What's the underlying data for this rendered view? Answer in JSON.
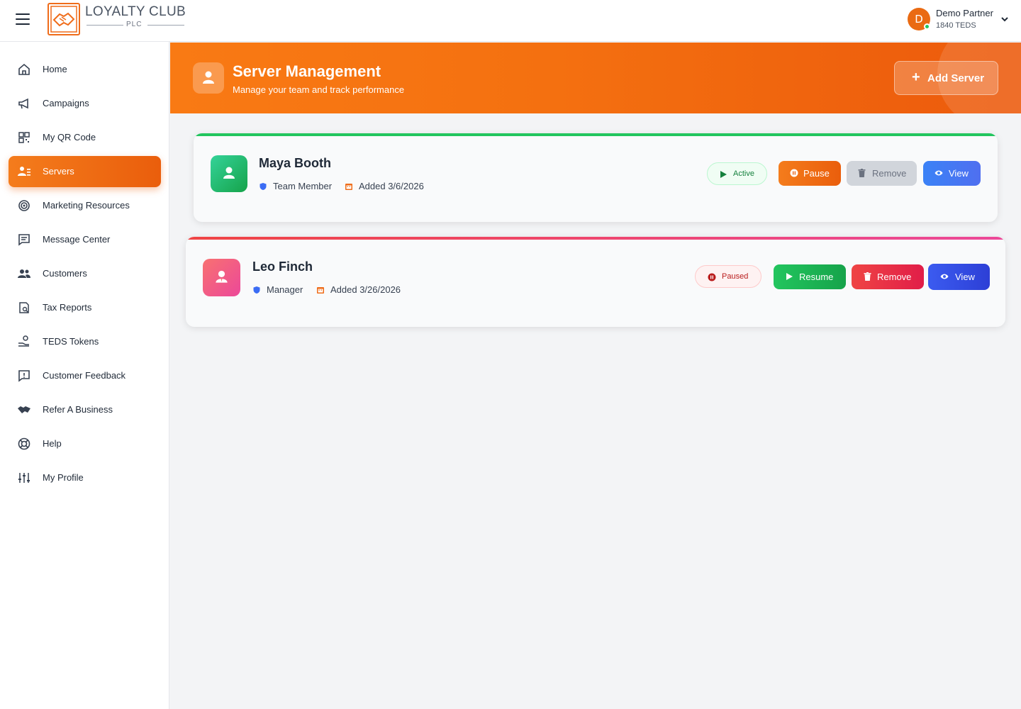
{
  "brand": {
    "title": "LOYALTY CLUB",
    "subtitle": "PLC"
  },
  "user": {
    "initial": "D",
    "name": "Demo Partner",
    "sub": "1840 TEDS"
  },
  "sidebar": {
    "items": [
      {
        "label": "Home",
        "icon": "home-icon"
      },
      {
        "label": "Campaigns",
        "icon": "megaphone-icon"
      },
      {
        "label": "My QR Code",
        "icon": "qr-code-icon"
      },
      {
        "label": "Servers",
        "icon": "servers-icon",
        "active": true
      },
      {
        "label": "Marketing Resources",
        "icon": "target-icon"
      },
      {
        "label": "Message Center",
        "icon": "message-icon"
      },
      {
        "label": "Customers",
        "icon": "users-icon"
      },
      {
        "label": "Tax Reports",
        "icon": "tax-report-icon"
      },
      {
        "label": "TEDS Tokens",
        "icon": "tokens-icon"
      },
      {
        "label": "Customer Feedback",
        "icon": "feedback-icon"
      },
      {
        "label": "Refer A Business",
        "icon": "handshake-icon"
      },
      {
        "label": "Help",
        "icon": "lifebuoy-icon"
      },
      {
        "label": "My Profile",
        "icon": "sliders-icon"
      }
    ]
  },
  "header": {
    "title": "Server Management",
    "subtitle": "Manage your team and track performance",
    "add_button": "Add Server"
  },
  "servers": [
    {
      "name": "Maya Booth",
      "role": "Team Member",
      "added": "Added 3/6/2026",
      "status": "Active",
      "actions": {
        "toggle": "Pause",
        "remove": "Remove",
        "view": "View"
      },
      "accent": "#22c55e"
    },
    {
      "name": "Leo Finch",
      "role": "Manager",
      "added": "Added 3/26/2026",
      "status": "Paused",
      "actions": {
        "toggle": "Resume",
        "remove": "Remove",
        "view": "View"
      },
      "accent": "#ef4444"
    }
  ],
  "colors": {
    "brand_orange": "#f47c1c",
    "active_green": "#22c55e",
    "paused_red": "#ef4444",
    "view_blue": "#3b6cf4"
  }
}
